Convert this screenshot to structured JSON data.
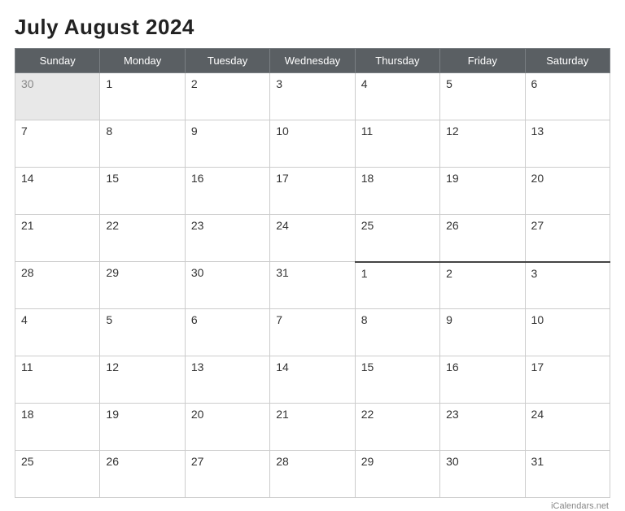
{
  "title": "July August 2024",
  "watermark": "iCalendars.net",
  "headers": [
    "Sunday",
    "Monday",
    "Tuesday",
    "Wednesday",
    "Thursday",
    "Friday",
    "Saturday"
  ],
  "weeks": [
    [
      {
        "day": "30",
        "prev": true
      },
      {
        "day": "1",
        "prev": false
      },
      {
        "day": "2",
        "prev": false
      },
      {
        "day": "3",
        "prev": false
      },
      {
        "day": "4",
        "prev": false
      },
      {
        "day": "5",
        "prev": false
      },
      {
        "day": "6",
        "prev": false
      }
    ],
    [
      {
        "day": "7",
        "prev": false
      },
      {
        "day": "8",
        "prev": false
      },
      {
        "day": "9",
        "prev": false
      },
      {
        "day": "10",
        "prev": false
      },
      {
        "day": "11",
        "prev": false
      },
      {
        "day": "12",
        "prev": false
      },
      {
        "day": "13",
        "prev": false
      }
    ],
    [
      {
        "day": "14",
        "prev": false
      },
      {
        "day": "15",
        "prev": false
      },
      {
        "day": "16",
        "prev": false
      },
      {
        "day": "17",
        "prev": false
      },
      {
        "day": "18",
        "prev": false
      },
      {
        "day": "19",
        "prev": false
      },
      {
        "day": "20",
        "prev": false
      }
    ],
    [
      {
        "day": "21",
        "prev": false
      },
      {
        "day": "22",
        "prev": false
      },
      {
        "day": "23",
        "prev": false
      },
      {
        "day": "24",
        "prev": false
      },
      {
        "day": "25",
        "prev": false
      },
      {
        "day": "26",
        "prev": false
      },
      {
        "day": "27",
        "prev": false
      }
    ],
    [
      {
        "day": "28",
        "prev": false,
        "divider": false
      },
      {
        "day": "29",
        "prev": false,
        "divider": false
      },
      {
        "day": "30",
        "prev": false,
        "divider": false
      },
      {
        "day": "31",
        "prev": false,
        "divider": false
      },
      {
        "day": "1",
        "prev": false,
        "divider": true
      },
      {
        "day": "2",
        "prev": false,
        "divider": true
      },
      {
        "day": "3",
        "prev": false,
        "divider": true
      }
    ],
    [
      {
        "day": "4",
        "prev": false
      },
      {
        "day": "5",
        "prev": false
      },
      {
        "day": "6",
        "prev": false
      },
      {
        "day": "7",
        "prev": false
      },
      {
        "day": "8",
        "prev": false
      },
      {
        "day": "9",
        "prev": false
      },
      {
        "day": "10",
        "prev": false
      }
    ],
    [
      {
        "day": "11",
        "prev": false
      },
      {
        "day": "12",
        "prev": false
      },
      {
        "day": "13",
        "prev": false
      },
      {
        "day": "14",
        "prev": false
      },
      {
        "day": "15",
        "prev": false
      },
      {
        "day": "16",
        "prev": false
      },
      {
        "day": "17",
        "prev": false
      }
    ],
    [
      {
        "day": "18",
        "prev": false
      },
      {
        "day": "19",
        "prev": false
      },
      {
        "day": "20",
        "prev": false
      },
      {
        "day": "21",
        "prev": false
      },
      {
        "day": "22",
        "prev": false
      },
      {
        "day": "23",
        "prev": false
      },
      {
        "day": "24",
        "prev": false
      }
    ],
    [
      {
        "day": "25",
        "prev": false
      },
      {
        "day": "26",
        "prev": false
      },
      {
        "day": "27",
        "prev": false
      },
      {
        "day": "28",
        "prev": false
      },
      {
        "day": "29",
        "prev": false
      },
      {
        "day": "30",
        "prev": false
      },
      {
        "day": "31",
        "prev": false
      }
    ]
  ]
}
